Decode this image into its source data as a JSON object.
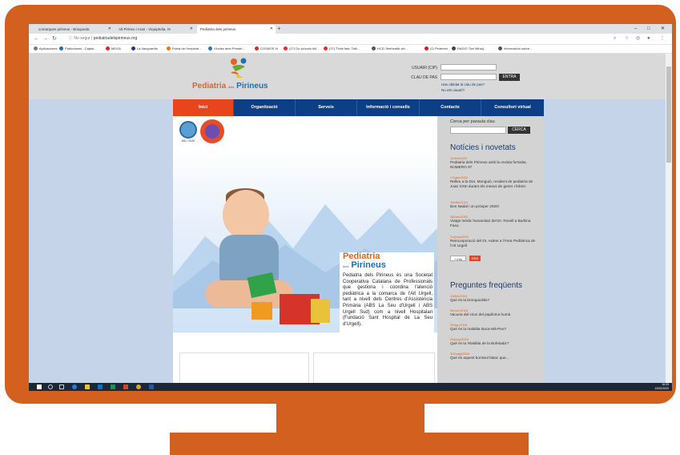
{
  "browser": {
    "tabs": [
      {
        "label": "comarques pirineus - Búsqueda"
      },
      {
        "label": "Alt Pirineu i Aran - Viquipèdia, l'e"
      },
      {
        "label": "Pediatria dels pirineus"
      }
    ],
    "url_prefix": "No segur",
    "url": "pediatriadelspirineus.org",
    "bookmarks": [
      {
        "label": "Aplicaciones",
        "color": "#7a7a7a"
      },
      {
        "label": "Particulares - Cajam...",
        "color": "#1b6fb5"
      },
      {
        "label": "MEGA",
        "color": "#d9272e"
      },
      {
        "label": "La Vanguardia",
        "color": "#1a3c7a"
      },
      {
        "label": "Portal de l'empleat ...",
        "color": "#e07b1a"
      },
      {
        "label": "Vincles amb Primàri...",
        "color": "#3a6fb0"
      },
      {
        "label": "COSNOS III",
        "color": "#c7332b"
      },
      {
        "label": "(27) Do schools kill...",
        "color": "#e52d27"
      },
      {
        "label": "(37) Think fast, Talk...",
        "color": "#e52d27"
      },
      {
        "label": "HCD-Telehealth-wh...",
        "color": "#555555"
      },
      {
        "label": "(1) Pinterest",
        "color": "#cb2027"
      },
      {
        "label": "RADIO Toni Mihaij...",
        "color": "#444444"
      },
      {
        "label": "Información sobre...",
        "color": "#555555"
      }
    ]
  },
  "site": {
    "logo_word1": "Pediatria",
    "logo_small": "dels",
    "logo_word2": "Pirineus",
    "login": {
      "user_label": "USUARI (CIP)",
      "pass_label": "CLAU DE PAS",
      "button": "ENTRA",
      "forgot": "Has oblidat la clau de pas?",
      "not_user": "No ets usuari?"
    },
    "nav": [
      {
        "label": "Inici"
      },
      {
        "label": "Organització"
      },
      {
        "label": "Serveis"
      },
      {
        "label": "Informació i consells"
      },
      {
        "label": "Contacte"
      },
      {
        "label": "Consultori virtual"
      }
    ],
    "badge_caption": "MIL.I.2020",
    "intro": {
      "title1": "Pediatria",
      "title_small": "dels",
      "title2": "Pirineus",
      "text": "Pediatria dels Pirineus és una Societat Cooperativa Catalana de Professionals que gestiona i coordina l'atenció pediàtrica a la comarca de l'Alt Urgell, tant a nivell dels Centres d'Assistència Primària (ABS La Seu d'Urgell i ABS Urgell Sud) com a nivell Hospitalari (Fundació Sant Hospital de La Seu d'Urgell)."
    },
    "sidebar": {
      "search_label": "Cerca per paraula clau",
      "search_button": "CERCA",
      "news_heading": "Notícies i novetats",
      "news": [
        {
          "date": "10/feb/2020",
          "title": "Pediatria dels Pirineus amb la revista ferSalut, NÚMERO 97"
        },
        {
          "date": "17/gen/2020",
          "title": "Relleu a la Dra. Monguió, resident de pediatria de Joan XXIII durant els mesos de gener i febrer"
        },
        {
          "date": "18/des/2019",
          "title": "Bon Nadal i un pròsper 2020!"
        },
        {
          "date": "08/nov/2019",
          "title": "Viatge mèdic humanitari del Dr. Rosell a Burkina Faso."
        },
        {
          "date": "21/juny/2019",
          "title": "Reincorporació del Dr. Aslete a l'Àrea Pediàtrica de l'Alt Urgell"
        }
      ],
      "more_label": "+ info",
      "rss_label": "RSS",
      "faq_heading": "Preguntes freqüents",
      "faq": [
        {
          "date": "13/feb/2019",
          "title": "Què és la bronquiolitis?"
        },
        {
          "date": "08/oct./2018",
          "title": "Vacuna del virus del papiloma humà"
        },
        {
          "date": "29/ag./2018",
          "title": "Què és la malaltia Boca-Mà-Peu?"
        },
        {
          "date": "29/juny/2018",
          "title": "Què és la 'Malaltia de la Bofetada'?"
        },
        {
          "date": "30/maig/2018",
          "title": "Què és aquest borissol blanc que..."
        }
      ]
    }
  },
  "taskbar": {
    "time": "16:33",
    "date": "13/02/2020"
  }
}
